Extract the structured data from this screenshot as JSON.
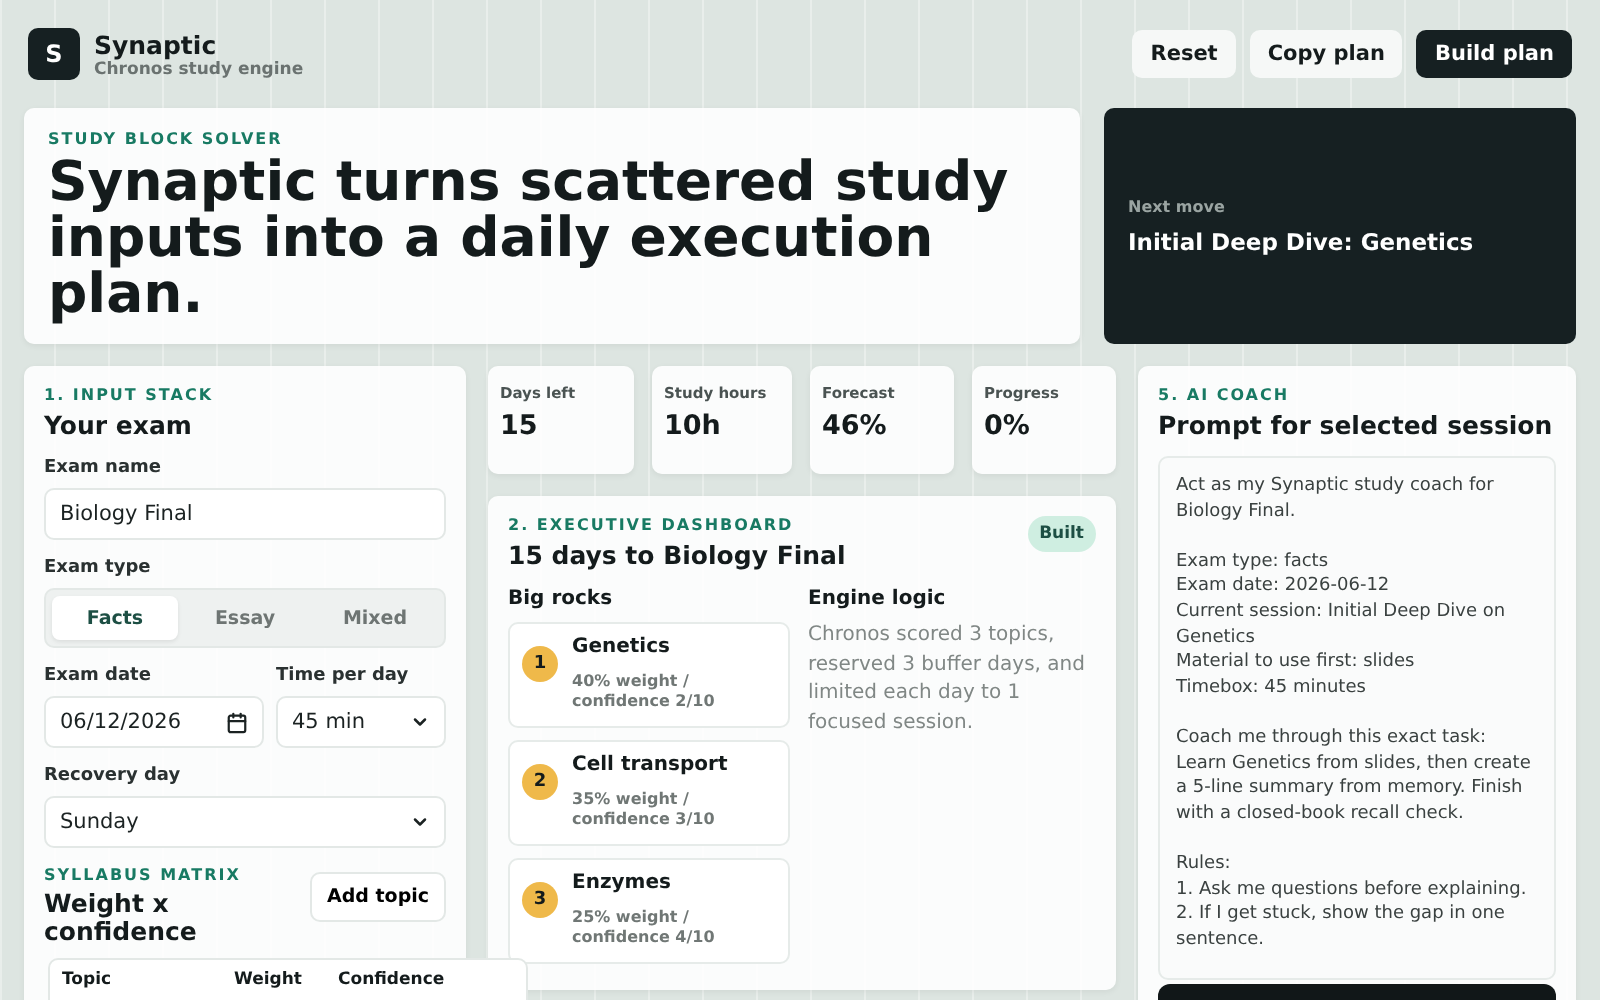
{
  "app": {
    "logo_letter": "S",
    "name": "Synaptic",
    "subtitle": "Chronos study engine"
  },
  "header_buttons": [
    {
      "label": "Reset",
      "kind": "light"
    },
    {
      "label": "Copy plan",
      "kind": "light"
    },
    {
      "label": "Build plan",
      "kind": "dark"
    }
  ],
  "hero": {
    "eyebrow": "STUDY BLOCK SOLVER",
    "headline": "Synaptic turns scattered study inputs into a daily execution plan."
  },
  "next_move": {
    "label": "Next move",
    "title": "Initial Deep Dive: Genetics"
  },
  "input_stack": {
    "eyebrow": "1. INPUT STACK",
    "title": "Your exam",
    "exam_name": {
      "label": "Exam name",
      "value": "Biology Final"
    },
    "exam_type": {
      "label": "Exam type",
      "options": [
        {
          "label": "Facts",
          "selected": true
        },
        {
          "label": "Essay",
          "selected": false
        },
        {
          "label": "Mixed",
          "selected": false
        }
      ]
    },
    "exam_date": {
      "label": "Exam date",
      "value": "06/12/2026"
    },
    "time_per_day": {
      "label": "Time per day",
      "value": "45 min"
    },
    "recovery_day": {
      "label": "Recovery day",
      "value": "Sunday"
    },
    "syllabus": {
      "eyebrow": "SYLLABUS MATRIX",
      "title": "Weight x confidence",
      "add_button": "Add topic",
      "columns": [
        "Topic",
        "Weight",
        "Confidence"
      ]
    }
  },
  "stats": [
    {
      "label": "Days left",
      "value": "15"
    },
    {
      "label": "Study hours",
      "value": "10h"
    },
    {
      "label": "Forecast",
      "value": "46%"
    },
    {
      "label": "Progress",
      "value": "0%"
    }
  ],
  "dashboard": {
    "eyebrow": "2. EXECUTIVE DASHBOARD",
    "title": "15 days to Biology Final",
    "status": "Built",
    "big_rocks_heading": "Big rocks",
    "rocks": [
      {
        "rank": "1",
        "name": "Genetics",
        "detail": "40% weight / confidence 2/10"
      },
      {
        "rank": "2",
        "name": "Cell transport",
        "detail": "35% weight / confidence 3/10"
      },
      {
        "rank": "3",
        "name": "Enzymes",
        "detail": "25% weight / confidence 4/10"
      }
    ],
    "logic_heading": "Engine logic",
    "logic_text": "Chronos scored 3 topics, reserved 3 buffer days, and limited each day to 1 focused session."
  },
  "coach": {
    "eyebrow": "5. AI COACH",
    "title": "Prompt for selected session",
    "prompt": "Act as my Synaptic study coach for Biology Final.\n\nExam type: facts\nExam date: 2026-06-12\nCurrent session: Initial Deep Dive on Genetics\nMaterial to use first: slides\nTimebox: 45 minutes\n\nCoach me through this exact task: Learn Genetics from slides, then create a 5-line summary from memory. Finish with a closed-book recall check.\n\nRules:\n1. Ask me questions before explaining.\n2. If I get stuck, show the gap in one sentence."
  }
}
